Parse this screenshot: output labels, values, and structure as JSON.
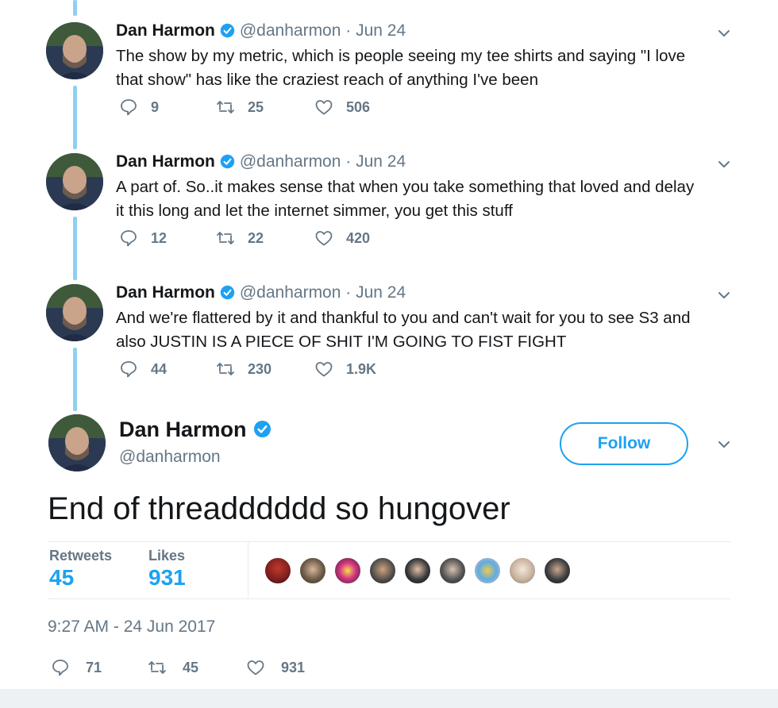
{
  "thread": [
    {
      "name": "Dan Harmon",
      "handle": "@danharmon",
      "dot": "·",
      "date": "Jun 24",
      "text": "The show by my metric, which is people seeing my tee shirts and saying \"I love that show\" has like the craziest reach of anything I've been",
      "replies": "9",
      "retweets": "25",
      "likes": "506"
    },
    {
      "name": "Dan Harmon",
      "handle": "@danharmon",
      "dot": "·",
      "date": "Jun 24",
      "text": "A part of. So..it makes sense that when you take something that loved and delay it this long and let the internet simmer, you get this stuff",
      "replies": "12",
      "retweets": "22",
      "likes": "420"
    },
    {
      "name": "Dan Harmon",
      "handle": "@danharmon",
      "dot": "·",
      "date": "Jun 24",
      "text": "And we're flattered by it and thankful to you and can't wait for you to see S3 and also JUSTIN IS A PIECE OF SHIT I'M GOING TO FIST FIGHT",
      "replies": "44",
      "retweets": "230",
      "likes": "1.9K"
    }
  ],
  "main": {
    "name": "Dan Harmon",
    "handle": "@danharmon",
    "follow_label": "Follow",
    "text": "End of threadddddd so hungover",
    "retweets_label": "Retweets",
    "retweets_count": "45",
    "likes_label": "Likes",
    "likes_count": "931",
    "timestamp": "9:27 AM - 24 Jun 2017",
    "replies": "71",
    "retweets": "45",
    "likes": "931"
  },
  "colors": {
    "accent": "#1da1f2",
    "muted": "#657786",
    "thread_line": "#8ed0f0"
  },
  "icons": [
    "reply-icon",
    "retweet-icon",
    "like-icon",
    "verified-icon",
    "chevron-down-icon"
  ]
}
